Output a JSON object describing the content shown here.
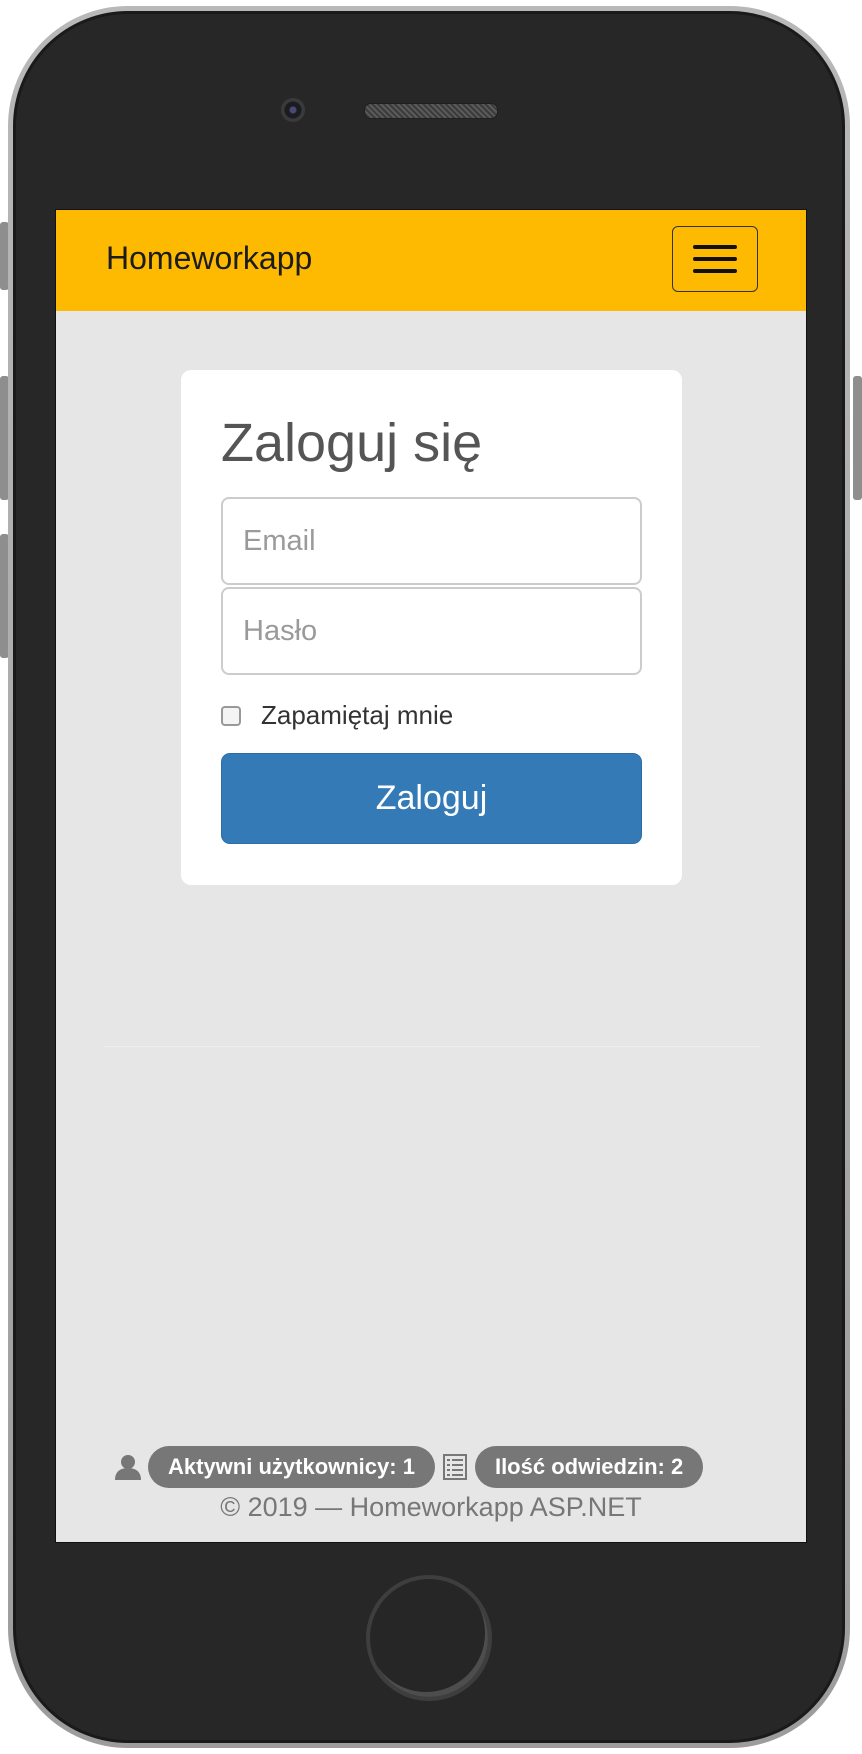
{
  "navbar": {
    "brand": "Homeworkapp",
    "brand_color": "#fdba00"
  },
  "login": {
    "title": "Zaloguj się",
    "email_placeholder": "Email",
    "password_placeholder": "Hasło",
    "remember_label": "Zapamiętaj mnie",
    "remember_checked": false,
    "submit_label": "Zaloguj",
    "submit_color": "#337ab7"
  },
  "footer": {
    "active_users": "Aktywni użytkownicy: 1",
    "visits": "Ilość odwiedzin: 2",
    "copyright": "© 2019 — Homeworkapp ASP.NET",
    "user_icon": "user-icon",
    "list_icon": "list-icon"
  }
}
